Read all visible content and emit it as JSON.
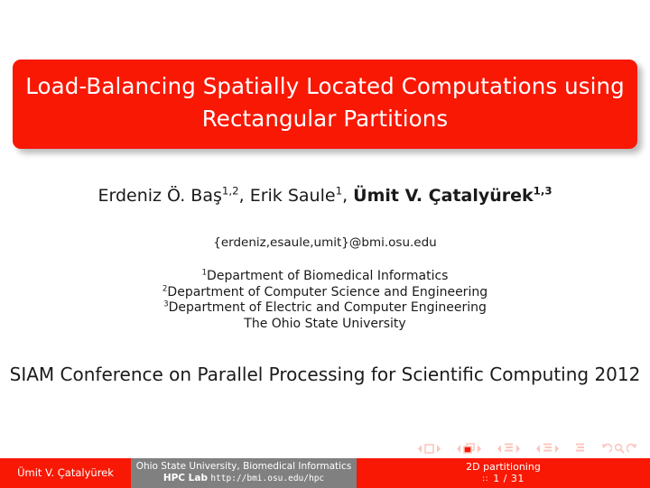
{
  "slide": {
    "title_lines": [
      "Load-Balancing Spatially Located Computations using",
      "Rectangular Partitions"
    ],
    "authors": {
      "a1_name": "Erdeniz Ö. Baş",
      "a1_sup": "1,2",
      "sep1": ", ",
      "a2_name": "Erik Saule",
      "a2_sup": "1",
      "sep2": ", ",
      "a3_name": "Ümit V. Çatalyürek",
      "a3_sup": "1,3"
    },
    "email": "{erdeniz,esaule,umit}@bmi.osu.edu",
    "affiliations": [
      {
        "sup": "1",
        "text": "Department of Biomedical Informatics"
      },
      {
        "sup": "2",
        "text": "Department of Computer Science and Engineering"
      },
      {
        "sup": "3",
        "text": "Department of Electric and Computer Engineering"
      }
    ],
    "institution": "The Ohio State University",
    "conference": "SIAM Conference on Parallel Processing for Scientific Computing 2012"
  },
  "navigation": {
    "slide_icon": "slide-navigation-icon",
    "frame_icon": "frame-navigation-icon",
    "subsection_icon": "subsection-navigation-icon",
    "section_icon": "section-navigation-icon",
    "doc_icon": "document-navigation-icon",
    "back_icon": "go-back-icon",
    "search_icon": "search-icon",
    "forward_icon": "go-forward-icon"
  },
  "footer": {
    "author_short": "Ümit V. Çatalyürek",
    "institute_line1": "Ohio State University, Biomedical Informatics",
    "institute_lab": "HPC Lab",
    "institute_url": "http://bmi.osu.edu/hpc",
    "section_title": "2D partitioning",
    "page_sep": "::",
    "page_number": "1 / 31"
  },
  "colors": {
    "accent_red": "#f91804",
    "footer_gray": "#808080",
    "nav_symbol": "#fcc6bd",
    "text": "#1a1a1a",
    "white": "#ffffff"
  }
}
